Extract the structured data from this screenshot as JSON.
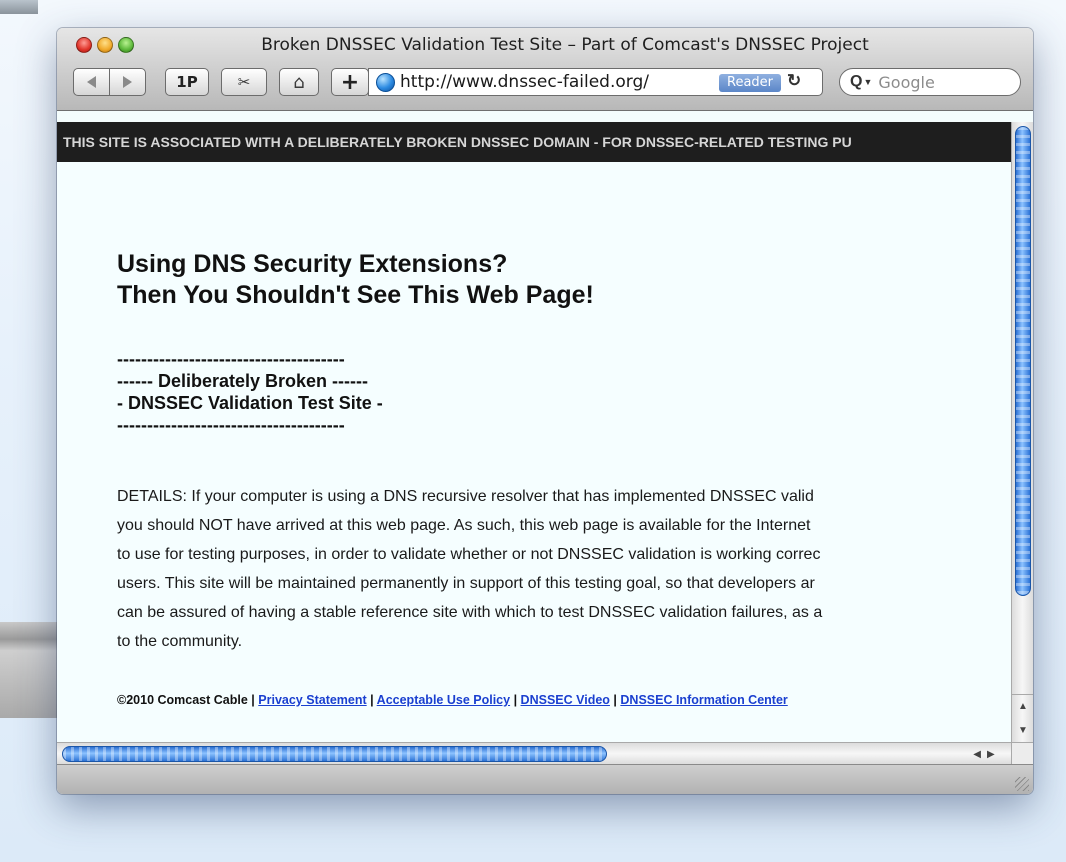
{
  "window": {
    "title": "Broken DNSSEC Validation Test Site – Part of Comcast's DNSSEC Project"
  },
  "toolbar": {
    "one_p_label": "1P",
    "plus_label": "+",
    "url": "http://www.dnssec-failed.org/",
    "reader_label": "Reader",
    "search_placeholder": "Google",
    "icons": [
      "back-icon",
      "forward-icon",
      "clip-icon",
      "home-icon",
      "globe-icon",
      "reload-icon",
      "search-icon"
    ]
  },
  "banner": {
    "text": "THIS SITE IS ASSOCIATED WITH A DELIBERATELY BROKEN DNSSEC DOMAIN - FOR DNSSEC-RELATED TESTING PU"
  },
  "page": {
    "heading_line1": "Using DNS Security Extensions?",
    "heading_line2": "Then You Shouldn't See This Web Page!",
    "divider_top": "--------------------------------------",
    "subtitle_line1": "------ Deliberately Broken ------",
    "subtitle_line2": "- DNSSEC Validation Test Site -",
    "divider_bottom": "--------------------------------------",
    "details_lines": [
      "DETAILS: If your computer is using a DNS recursive resolver that has implemented DNSSEC valid",
      "you should NOT have arrived at this web page. As such, this web page is available for the Internet",
      "to use for testing purposes, in order to validate whether or not DNSSEC validation is working correc",
      "users. This site will be maintained permanently in support of this testing goal, so that developers ar",
      "can be assured of having a stable reference site with which to test DNSSEC validation failures, as a",
      "to the community."
    ]
  },
  "footer": {
    "copyright": "©2010 Comcast Cable",
    "separator": "|",
    "links": [
      "Privacy Statement",
      "Acceptable Use Policy",
      "DNSSEC Video",
      "DNSSEC Information Center"
    ]
  },
  "colors": {
    "banner_bg": "#1e1e1e",
    "page_bg": "#f5feff",
    "link": "#1a3fd0",
    "scroll_thumb": "#3b82e0"
  }
}
